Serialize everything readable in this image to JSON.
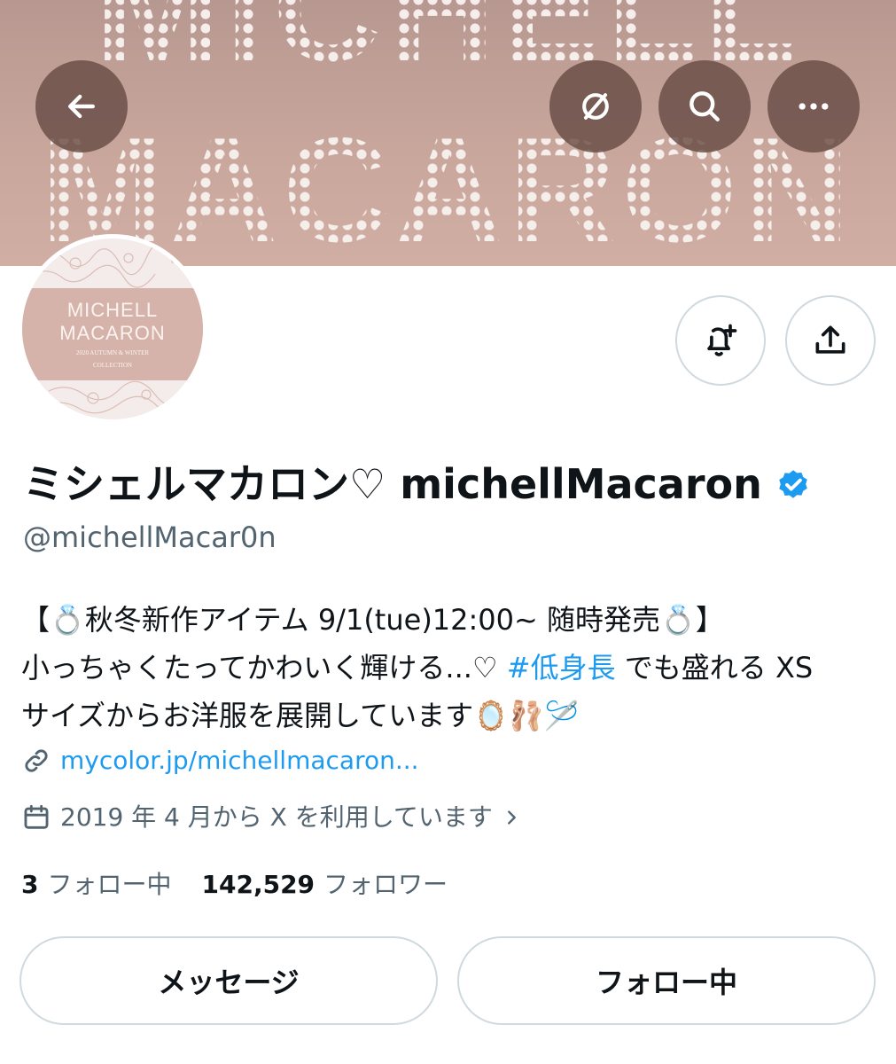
{
  "banner": {
    "line1": "MICHELL",
    "line2": "MACARON"
  },
  "top_actions": {
    "back": "arrow-left-icon",
    "translate": "eye-off-icon",
    "search": "search-icon",
    "more": "more-icon"
  },
  "avatar": {
    "title": "MICHELL MACARON",
    "subtitle_line1": "2020 AUTUMN & WINTER",
    "subtitle_line2": "COLLECTION"
  },
  "profile_actions": {
    "notify": "bell-plus-icon",
    "share": "share-icon"
  },
  "profile": {
    "display_name": "ミシェルマカロン♡ michellMacaron",
    "handle": "@michellMacar0n",
    "verified_color": "#1d9bf0",
    "bio": {
      "line1": "【💍秋冬新作アイテム 9/1(tue)12:00~ 随時発売💍】",
      "line2_a": "小っちゃくたってかわいく輝ける...♡ ",
      "line2_hashtag": "#低身長",
      "line2_b": " でも盛れる XS",
      "line3": "サイズからお洋服を展開しています🪞🩰🪡"
    },
    "link": "mycolor.jp/michellmacaron...",
    "joined": "2019 年 4 月から X を利用しています"
  },
  "stats": {
    "following_count": "3",
    "following_label": "フォロー中",
    "followers_count": "142,529",
    "followers_label": "フォロワー"
  },
  "buttons": {
    "message": "メッセージ",
    "following": "フォロー中"
  }
}
